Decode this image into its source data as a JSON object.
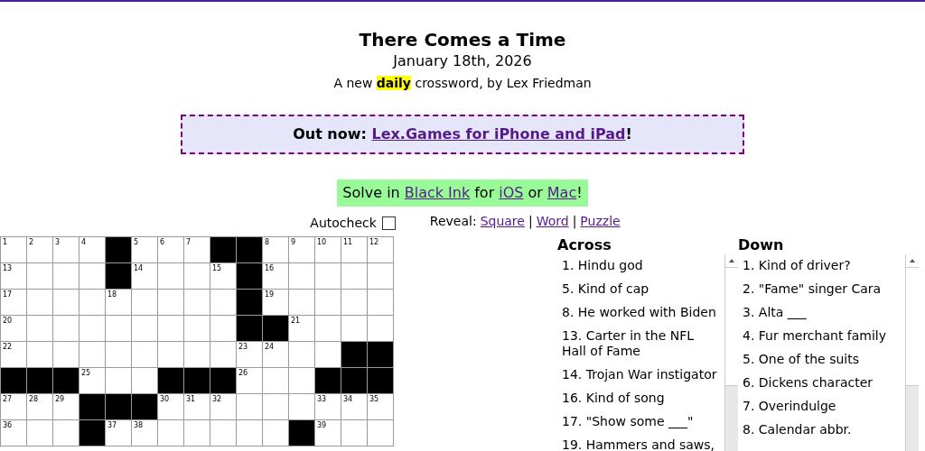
{
  "title": "There Comes a Time",
  "date": "January 18th, 2026",
  "byline": "A new **daily** crossword, by Lex Friedman",
  "banner": {
    "label": "Out now:",
    "link": "Lex.Games for iPhone and iPad",
    "end": "!"
  },
  "solve": {
    "parts": [
      {
        "kind": "text",
        "text": "Solve in"
      },
      {
        "kind": "link",
        "text": "Black Ink"
      },
      {
        "kind": "text",
        "text": "for"
      },
      {
        "kind": "link",
        "text": "iOS"
      },
      {
        "kind": "text",
        "text": "or"
      },
      {
        "kind": "link",
        "text": "Mac"
      },
      {
        "kind": "punct",
        "text": "!"
      }
    ]
  },
  "autocheck": {
    "label": "Autocheck",
    "checked": false
  },
  "reveal": {
    "label": "Reveal:",
    "separator": "|",
    "links": [
      "Square",
      "Word",
      "Puzzle"
    ]
  },
  "grid": [
    [
      {
        "kind": "open",
        "n": "1"
      },
      {
        "kind": "open",
        "n": "2"
      },
      {
        "kind": "open",
        "n": "3"
      },
      {
        "kind": "open",
        "n": "4"
      },
      {
        "kind": "block"
      },
      {
        "kind": "open",
        "n": "5"
      },
      {
        "kind": "open",
        "n": "6"
      },
      {
        "kind": "open",
        "n": "7"
      },
      {
        "kind": "block"
      },
      {
        "kind": "block"
      },
      {
        "kind": "open",
        "n": "8"
      },
      {
        "kind": "open",
        "n": "9"
      },
      {
        "kind": "open",
        "n": "10"
      },
      {
        "kind": "open",
        "n": "11"
      },
      {
        "kind": "open",
        "n": "12"
      }
    ],
    [
      {
        "kind": "open",
        "n": "13"
      },
      {
        "kind": "open"
      },
      {
        "kind": "open"
      },
      {
        "kind": "open"
      },
      {
        "kind": "block"
      },
      {
        "kind": "open",
        "n": "14"
      },
      {
        "kind": "open"
      },
      {
        "kind": "open"
      },
      {
        "kind": "open",
        "n": "15"
      },
      {
        "kind": "block"
      },
      {
        "kind": "open",
        "n": "16"
      },
      {
        "kind": "open"
      },
      {
        "kind": "open"
      },
      {
        "kind": "open"
      },
      {
        "kind": "open"
      }
    ],
    [
      {
        "kind": "open",
        "n": "17"
      },
      {
        "kind": "open"
      },
      {
        "kind": "open"
      },
      {
        "kind": "open"
      },
      {
        "kind": "open",
        "n": "18"
      },
      {
        "kind": "open"
      },
      {
        "kind": "open"
      },
      {
        "kind": "open"
      },
      {
        "kind": "open"
      },
      {
        "kind": "block"
      },
      {
        "kind": "open",
        "n": "19"
      },
      {
        "kind": "open"
      },
      {
        "kind": "open"
      },
      {
        "kind": "open"
      },
      {
        "kind": "open"
      }
    ],
    [
      {
        "kind": "open",
        "n": "20"
      },
      {
        "kind": "open"
      },
      {
        "kind": "open"
      },
      {
        "kind": "open"
      },
      {
        "kind": "open"
      },
      {
        "kind": "open"
      },
      {
        "kind": "open"
      },
      {
        "kind": "open"
      },
      {
        "kind": "open"
      },
      {
        "kind": "block"
      },
      {
        "kind": "block"
      },
      {
        "kind": "open",
        "n": "21"
      },
      {
        "kind": "open"
      },
      {
        "kind": "open"
      },
      {
        "kind": "open"
      }
    ],
    [
      {
        "kind": "open",
        "n": "22"
      },
      {
        "kind": "open"
      },
      {
        "kind": "open"
      },
      {
        "kind": "open"
      },
      {
        "kind": "open"
      },
      {
        "kind": "open"
      },
      {
        "kind": "open"
      },
      {
        "kind": "open"
      },
      {
        "kind": "open"
      },
      {
        "kind": "open",
        "n": "23"
      },
      {
        "kind": "open",
        "n": "24"
      },
      {
        "kind": "open"
      },
      {
        "kind": "open"
      },
      {
        "kind": "block"
      },
      {
        "kind": "block"
      }
    ],
    [
      {
        "kind": "block"
      },
      {
        "kind": "block"
      },
      {
        "kind": "block"
      },
      {
        "kind": "open",
        "n": "25"
      },
      {
        "kind": "open"
      },
      {
        "kind": "open"
      },
      {
        "kind": "block"
      },
      {
        "kind": "block"
      },
      {
        "kind": "block"
      },
      {
        "kind": "open",
        "n": "26"
      },
      {
        "kind": "open"
      },
      {
        "kind": "open"
      },
      {
        "kind": "block"
      },
      {
        "kind": "block"
      },
      {
        "kind": "block"
      }
    ],
    [
      {
        "kind": "open",
        "n": "27"
      },
      {
        "kind": "open",
        "n": "28"
      },
      {
        "kind": "open",
        "n": "29"
      },
      {
        "kind": "block"
      },
      {
        "kind": "block"
      },
      {
        "kind": "block"
      },
      {
        "kind": "open",
        "n": "30"
      },
      {
        "kind": "open",
        "n": "31"
      },
      {
        "kind": "open",
        "n": "32"
      },
      {
        "kind": "open"
      },
      {
        "kind": "open"
      },
      {
        "kind": "open"
      },
      {
        "kind": "open",
        "n": "33"
      },
      {
        "kind": "open",
        "n": "34"
      },
      {
        "kind": "open",
        "n": "35"
      }
    ],
    [
      {
        "kind": "open",
        "n": "36"
      },
      {
        "kind": "open"
      },
      {
        "kind": "open"
      },
      {
        "kind": "block"
      },
      {
        "kind": "open",
        "n": "37"
      },
      {
        "kind": "open",
        "n": "38"
      },
      {
        "kind": "open"
      },
      {
        "kind": "open"
      },
      {
        "kind": "open"
      },
      {
        "kind": "open"
      },
      {
        "kind": "open"
      },
      {
        "kind": "block"
      },
      {
        "kind": "open",
        "n": "39"
      },
      {
        "kind": "open"
      },
      {
        "kind": "open"
      }
    ]
  ],
  "clues": [
    {
      "heading": "Across",
      "items": [
        "1. Hindu god",
        "5. Kind of cap",
        "8. He worked with Biden",
        "13. Carter in the NFL Hall of Fame",
        "14. Trojan War instigator",
        "16. Kind of song",
        "17. \"Show some ___\"",
        "19. Hammers and saws,"
      ]
    },
    {
      "heading": "Down",
      "items": [
        "1. Kind of driver?",
        "2. \"Fame\" singer Cara",
        "3. Alta ___",
        "4. Fur merchant family",
        "5. One of the suits",
        "6. Dickens character",
        "7. Overindulge",
        "8. Calendar abbr."
      ]
    }
  ]
}
